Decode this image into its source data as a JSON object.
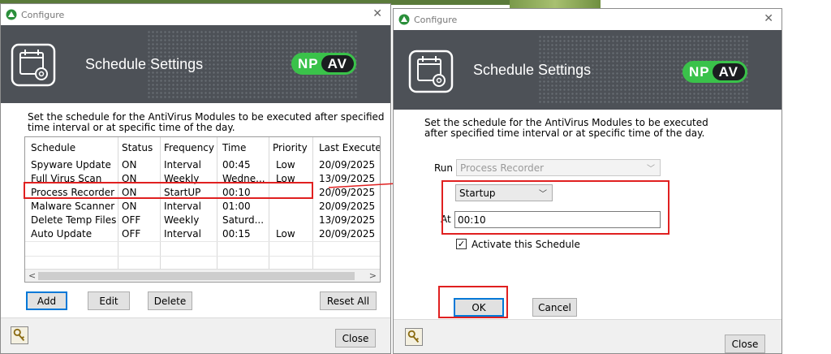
{
  "window1": {
    "title": "Configure",
    "banner_title": "Schedule Settings",
    "brand_np": "NP",
    "brand_av": "AV",
    "description": "Set the schedule for the AntiVirus Modules to be executed after specified time interval or at specific time of the day.",
    "table": {
      "columns": [
        "Schedule",
        "Status",
        "Frequency",
        "Time",
        "Priority",
        "Last Execute"
      ],
      "rows": [
        [
          "Spyware Update",
          "ON",
          "Interval",
          "00:45",
          "Low",
          "20/09/2025"
        ],
        [
          "Full Virus Scan",
          "ON",
          "Weekly",
          "Wedne...",
          "Low",
          "13/09/2025"
        ],
        [
          "Process Recorder",
          "ON",
          "StartUP",
          "00:10",
          "",
          "20/09/2025"
        ],
        [
          "Malware Scanner",
          "ON",
          "Interval",
          "01:00",
          "",
          "20/09/2025"
        ],
        [
          "Delete Temp Files",
          "OFF",
          "Weekly",
          "Saturd...",
          "",
          "13/09/2025"
        ],
        [
          "Auto Update",
          "OFF",
          "Interval",
          "00:15",
          "Low",
          "20/09/2025"
        ]
      ]
    },
    "buttons": {
      "add": "Add",
      "edit": "Edit",
      "delete": "Delete",
      "reset_all": "Reset All",
      "close": "Close"
    }
  },
  "window2": {
    "title": "Configure",
    "banner_title": "Schedule Settings",
    "brand_np": "NP",
    "brand_av": "AV",
    "description": "Set the schedule for the AntiVirus Modules to be executed after specified time interval or at specific time of the day.",
    "run_label": "Run",
    "run_value": "Process Recorder",
    "frequency_value": "Startup",
    "at_label": "At",
    "at_value": "00:10",
    "activate_label": "Activate this Schedule",
    "activate_checked": true,
    "buttons": {
      "ok": "OK",
      "cancel": "Cancel",
      "close": "Close"
    }
  },
  "colors": {
    "banner": "#4d5157",
    "brand_green": "#3ac24a",
    "highlight_red": "#e02020",
    "focus_blue": "#0078d7"
  }
}
